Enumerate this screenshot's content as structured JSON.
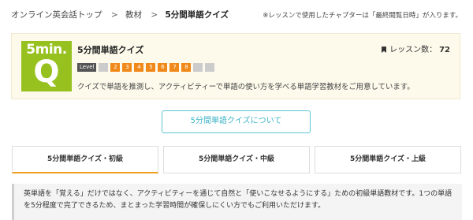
{
  "breadcrumb": {
    "items": [
      "オンライン英会話トップ",
      "教材"
    ],
    "separator": ">",
    "current": "5分間単語クイズ"
  },
  "note": "※レッスンで使用したチャプターは「最終閲覧日時」が入ります。",
  "course": {
    "logo_line1": "5min.",
    "logo_line2": "Q",
    "title": "5分間単語クイズ",
    "lesson_count_label": "レッスン数：",
    "lesson_count": "72",
    "level_label": "Level",
    "levels": [
      {
        "label": "",
        "active": false
      },
      {
        "label": "2",
        "active": true
      },
      {
        "label": "3",
        "active": true
      },
      {
        "label": "4",
        "active": true
      },
      {
        "label": "5",
        "active": true
      },
      {
        "label": "6",
        "active": true
      },
      {
        "label": "7",
        "active": true
      },
      {
        "label": "8",
        "active": true
      },
      {
        "label": "",
        "active": false
      },
      {
        "label": "",
        "active": false
      }
    ],
    "description": "クイズで単語を推測し、アクティビティーで単語の使い方を学べる単語学習教材をご用意しています。"
  },
  "about_button": "5分間単語クイズについて",
  "tabs": [
    {
      "label": "5分間単語クイズ・初級",
      "active": true
    },
    {
      "label": "5分間単語クイズ・中級",
      "active": false
    },
    {
      "label": "5分間単語クイズ・上級",
      "active": false
    }
  ],
  "info_text": "英単語を「覚える」だけではなく、アクティビティーを通じて自然と「使いこなせるようにする」ための初級単語教材です。1つの単語を5分程度で完了できるため、まとまった学習時間が確保しにくい方でもご利用いただけます。",
  "colors": {
    "logo_green": "#97c11f",
    "level_active": "#f0891a",
    "accent_teal": "#3cb3c6",
    "tab_underline": "#f0a020"
  }
}
